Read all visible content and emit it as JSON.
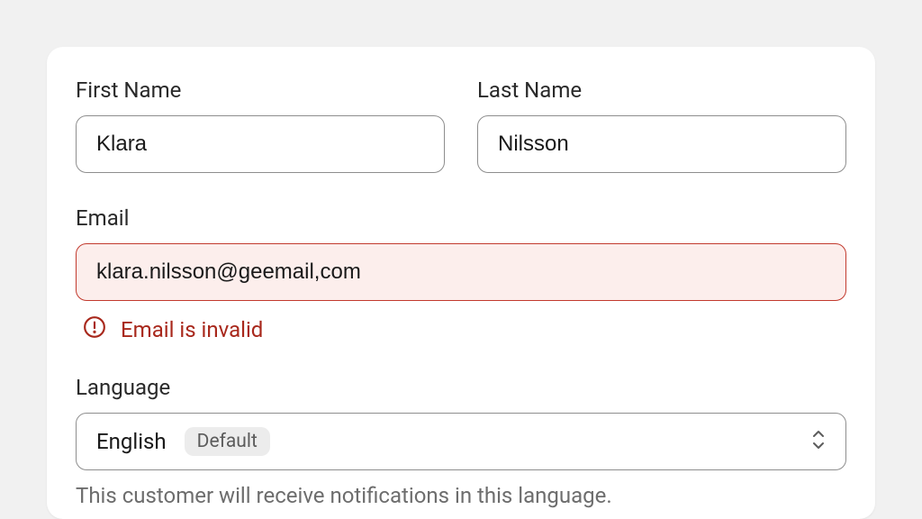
{
  "form": {
    "first_name": {
      "label": "First Name",
      "value": "Klara"
    },
    "last_name": {
      "label": "Last Name",
      "value": "Nilsson"
    },
    "email": {
      "label": "Email",
      "value": "klara.nilsson@geemail,com",
      "error": "Email is invalid"
    },
    "language": {
      "label": "Language",
      "value": "English",
      "badge": "Default",
      "helper": "This customer will receive notifications in this language."
    }
  },
  "colors": {
    "error": "#a8281c",
    "error_bg": "#fceeec",
    "border": "#8e8e8e",
    "muted": "#6d6d6d"
  }
}
